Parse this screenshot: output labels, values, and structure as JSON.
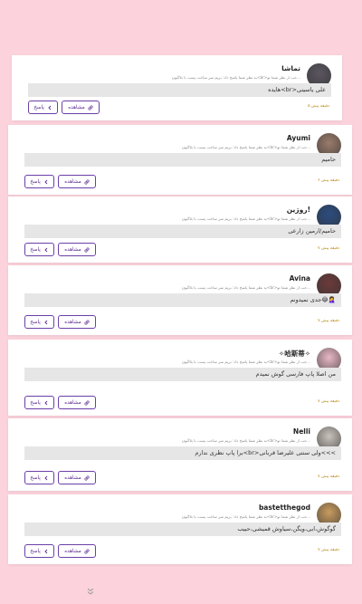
{
  "comments": [
    {
      "name": "تماشا",
      "subtitle": "به نظر شما پاسخ داد: بریم سر ساخت پست با بلاگیون<br>جب از نظر شما تو...",
      "comment": "هایده<br>علی یاسینی",
      "time": "۵ دقیقه پیش",
      "reply_label": "پاسخ",
      "view_label": "مشاهده",
      "avatar_color": "#5b5560"
    },
    {
      "name": "Ayumi",
      "subtitle": "به نظر شما پاسخ داد: بریم سر ساخت پست با بلاگیون<br>جب از نظر شما تو...",
      "comment": "حامیم",
      "time": "۶ دقیقه پیش",
      "reply_label": "پاسخ",
      "view_label": "مشاهده",
      "avatar_color": "#9a7b6a"
    },
    {
      "name": "روژین!",
      "subtitle": "به نظر شما پاسخ داد: بریم سر ساخت پست با بلاگیون<br>جب از نظر شما تو...",
      "comment": "حامیم/ارمین زارعی",
      "time": "۷ دقیقه پیش",
      "reply_label": "پاسخ",
      "view_label": "مشاهده",
      "avatar_color": "#2b4c80"
    },
    {
      "name": "Avina",
      "subtitle": "به نظر شما پاسخ داد: بریم سر ساخت پست با بلاگیون<br>جب از نظر شما تو...",
      "comment": "جدی نمیدونم😂🤦‍♀️",
      "time": "۷ دقیقه پیش",
      "reply_label": "پاسخ",
      "view_label": "مشاهده",
      "avatar_color": "#6b3a3a"
    },
    {
      "name": "✧哈斯蒂✧",
      "subtitle": "به نظر شما پاسخ داد: بریم سر ساخت پست با بلاگیون<br>جب از نظر شما تو...",
      "comment": "من اصلا پاپ فارسی گوش نمیدم",
      "time": "۷ دقیقه پیش",
      "reply_label": "پاسخ",
      "view_label": "مشاهده",
      "avatar_color": "#e8b7c4"
    },
    {
      "name": "Nelli",
      "subtitle": "به نظر شما پاسخ داد: بریم سر ساخت پست با بلاگیون<br>جب از نظر شما تو...",
      "comment": "برا پاپ نظری ندارم<br>ولی سنتی علیرضا قربانی<<<",
      "time": "۷ دقیقه پیش",
      "reply_label": "پاسخ",
      "view_label": "مشاهده",
      "avatar_color": "#c9c2bb"
    },
    {
      "name": "bastetthegod",
      "subtitle": "به نظر شما پاسخ داد: بریم سر ساخت پست با بلاگیون<br>جب از نظر شما تو...",
      "comment": "گوگوش،ابی،ویگن،سیاوش قمیشی،حبیب",
      "time": "۷ دقیقه پیش",
      "reply_label": "پاسخ",
      "view_label": "مشاهده",
      "avatar_color": "#c89b5e"
    }
  ],
  "colors": {
    "background": "#fcd3dc",
    "accent": "#5b2c91",
    "time": "#b8860b"
  },
  "icons": {
    "reply": "chevron-left-icon",
    "view": "link-icon",
    "more": "chevrons-down-icon"
  }
}
